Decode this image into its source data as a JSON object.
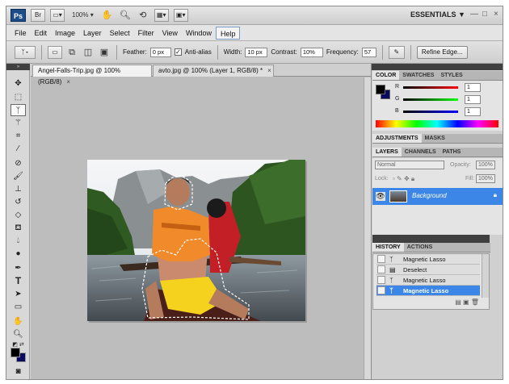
{
  "appbar": {
    "logo": "Ps",
    "bridge": "Br",
    "zoom": "100%",
    "workspace": "ESSENTIALS ▼",
    "win_min": "—",
    "win_max": "□",
    "win_close": "×",
    "icons": [
      "view-extras-icon",
      "hand-icon",
      "zoom-icon",
      "rotate-icon",
      "arrange-icon",
      "screen-mode-icon"
    ]
  },
  "menu": [
    "File",
    "Edit",
    "Image",
    "Layer",
    "Select",
    "Filter",
    "View",
    "Window",
    "Help"
  ],
  "options": {
    "feather_label": "Feather:",
    "feather_value": "0 px",
    "antialias_label": "Anti-alias",
    "width_label": "Width:",
    "width_value": "10 px",
    "contrast_label": "Contrast:",
    "contrast_value": "10%",
    "frequency_label": "Frequency:",
    "frequency_value": "57",
    "refine_label": "Refine Edge..."
  },
  "tabs": [
    {
      "label": "Angel-Falls-Trip.jpg @ 100% (RGB/8)",
      "close": "×",
      "active": true
    },
    {
      "label": "avto.jpg @ 100% (Layer 1, RGB/8) *",
      "close": "×",
      "active": false
    }
  ],
  "color_panel": {
    "tabs": [
      "COLOR",
      "SWATCHES",
      "STYLES"
    ],
    "r_label": "R",
    "g_label": "G",
    "b_label": "B",
    "r": "1",
    "g": "1",
    "b": "1",
    "fg": "#000000",
    "bg": "#0a0a60"
  },
  "adjust_panel": {
    "tabs": [
      "ADJUSTMENTS",
      "MASKS"
    ]
  },
  "layers_panel": {
    "tabs": [
      "LAYERS",
      "CHANNELS",
      "PATHS"
    ],
    "blend_mode": "Normal",
    "opacity_label": "Opacity:",
    "opacity": "100%",
    "lock_label": "Lock:",
    "fill_label": "Fill:",
    "fill": "100%",
    "layer_name": "Background"
  },
  "history_panel": {
    "tabs": [
      "HISTORY",
      "ACTIONS"
    ],
    "items": [
      "Magnetic Lasso",
      "Deselect",
      "Magnetic Lasso",
      "Magnetic Lasso"
    ]
  },
  "colors": {
    "accent": "#3b86e6"
  }
}
